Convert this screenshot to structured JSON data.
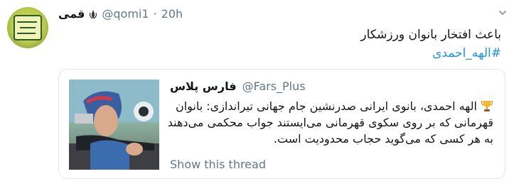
{
  "tweet": {
    "display_name": "قمی",
    "handle": "@qomi1",
    "separator": "·",
    "time": "20h",
    "text_line": "باعث افتخار بانوان ورزشکار",
    "hashtag": "#الهه_احمدی"
  },
  "quoted": {
    "display_name": "فارس پلاس",
    "handle": "@Fars_Plus",
    "text": "الهه احمدی، بانوی ایرانی صدرنشین جام جهانی تیراندازی: بانوان قهرمانی که بر روی سکوی قهرمانی می‌ایستند جواب محکمی می‌دهند به هر کسی که می‌گوید حجاب محدودیت است.",
    "show_thread": "Show this thread"
  },
  "icons": {
    "emblem": "iran-emblem-icon",
    "caret": "chevron-down-icon",
    "trophy": "trophy-icon"
  },
  "colors": {
    "link": "#1b95e0",
    "secondary_text": "#657786",
    "border": "#e1e8ed"
  }
}
